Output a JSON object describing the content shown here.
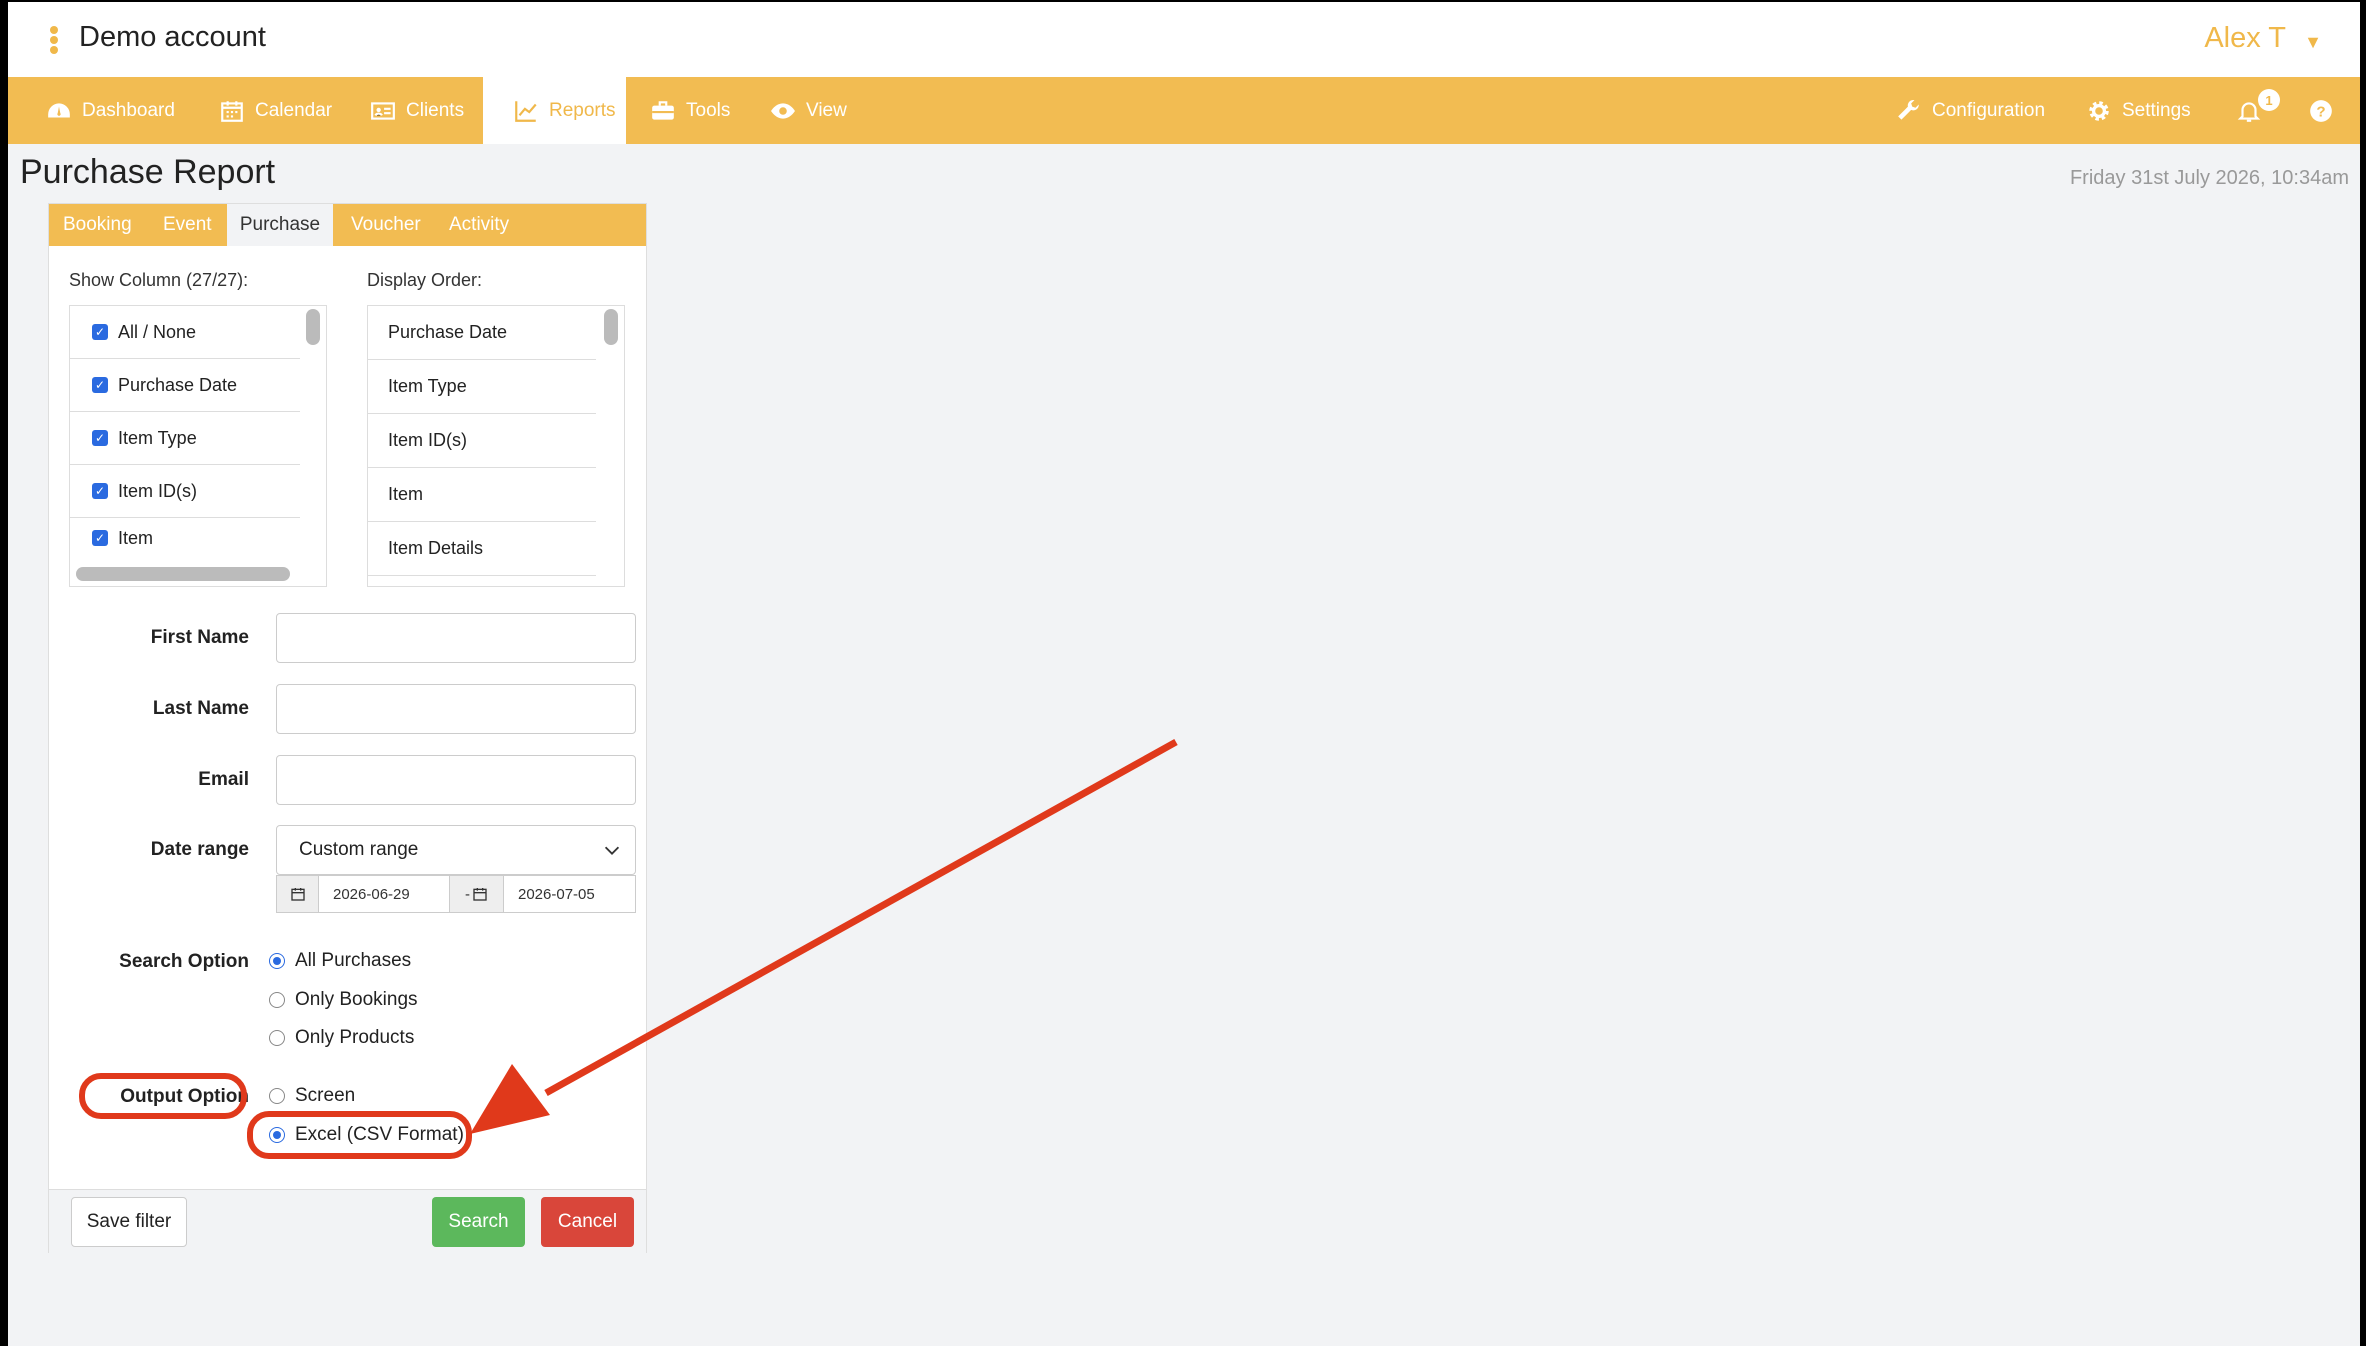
{
  "header": {
    "account_name": "Demo account",
    "user_name": "Alex T"
  },
  "nav": {
    "items": [
      {
        "label": "Dashboard",
        "icon": "dashboard-icon"
      },
      {
        "label": "Calendar",
        "icon": "calendar-icon"
      },
      {
        "label": "Clients",
        "icon": "id-card-icon"
      },
      {
        "label": "Reports",
        "icon": "chart-icon",
        "active": true
      },
      {
        "label": "Tools",
        "icon": "briefcase-icon"
      },
      {
        "label": "View",
        "icon": "eye-icon"
      }
    ],
    "right": {
      "configuration": "Configuration",
      "settings": "Settings",
      "notification_count": "1"
    }
  },
  "page": {
    "title": "Purchase Report",
    "datetime": "Friday 31st July 2026, 10:34am"
  },
  "tabs": [
    {
      "label": "Booking"
    },
    {
      "label": "Event"
    },
    {
      "label": "Purchase",
      "active": true
    },
    {
      "label": "Voucher"
    },
    {
      "label": "Activity"
    }
  ],
  "columns": {
    "show_label": "Show Column (27/27):",
    "items": [
      "All / None",
      "Purchase Date",
      "Item Type",
      "Item ID(s)",
      "Item"
    ]
  },
  "display_order": {
    "label": "Display Order:",
    "items": [
      "Purchase Date",
      "Item Type",
      "Item ID(s)",
      "Item",
      "Item Details"
    ]
  },
  "form": {
    "first_name_label": "First Name",
    "last_name_label": "Last Name",
    "email_label": "Email",
    "date_range_label": "Date range",
    "date_range_value": "Custom range",
    "date_from": "2026-06-29",
    "date_to": "2026-07-05",
    "date_separator": "-",
    "search_option_label": "Search Option",
    "search_options": [
      "All Purchases",
      "Only Bookings",
      "Only Products"
    ],
    "search_option_selected": "All Purchases",
    "output_option_label": "Output Option",
    "output_options": [
      "Screen",
      "Excel (CSV Format)"
    ],
    "output_option_selected": "Excel (CSV Format)"
  },
  "buttons": {
    "save_filter": "Save filter",
    "search": "Search",
    "cancel": "Cancel"
  },
  "annotation": {
    "color": "#e0391b"
  },
  "colors": {
    "brand": "#f2bc52",
    "success": "#5cb85c",
    "danger": "#d9463a",
    "primary": "#2a6ae0"
  }
}
